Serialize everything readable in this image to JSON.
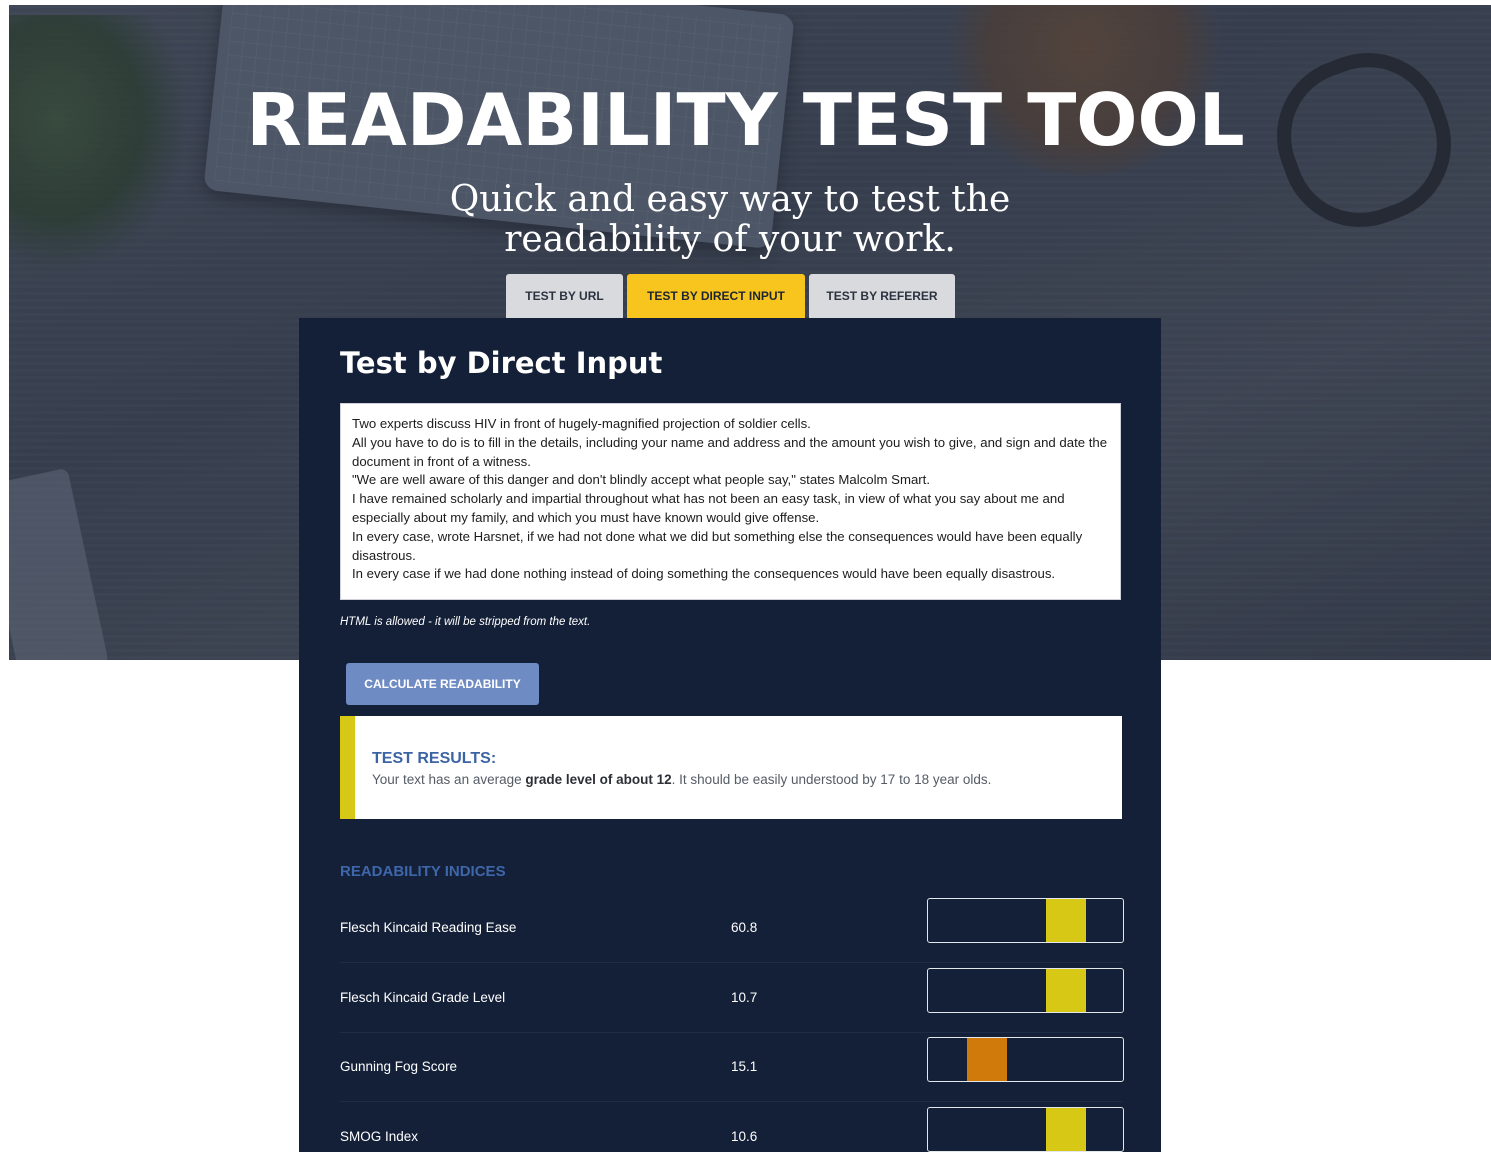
{
  "header": {
    "title": "READABILITY TEST TOOL",
    "subtitle": "Quick and easy way to test the readability of your work."
  },
  "tabs": [
    {
      "label": "TEST BY URL",
      "active": false
    },
    {
      "label": "TEST BY DIRECT INPUT",
      "active": true
    },
    {
      "label": "TEST BY REFERER",
      "active": false
    }
  ],
  "panel": {
    "title": "Test by Direct Input",
    "input_text": "Two experts discuss HIV in front of hugely-magnified projection of soldier cells.\nAll you have to do is to fill in the details, including your name and address and the amount you wish to give, and sign and date the document in front of a witness.\n\"We are well aware of this danger and don't blindly accept what people say,\" states Malcolm Smart.\nI have remained scholarly and impartial throughout what has not been an easy task, in view of what you say about me and especially about my family, and which you must have known would give offense.\nIn every case, wrote Harsnet, if we had not done what we did but something else the consequences would have been equally disastrous.\nIn every case if we had done nothing instead of doing something the consequences would have been equally disastrous.",
    "input_note": "HTML is allowed - it will be stripped from the text.",
    "calculate_label": "CALCULATE READABILITY"
  },
  "results": {
    "label": "TEST RESULTS:",
    "text_prefix": "Your text has an average",
    "grade_bold": "grade level of about 12",
    "text_suffix": ". It should be easily understood by 17 to 18 year olds."
  },
  "indices": {
    "title": "READABILITY INDICES",
    "items": [
      {
        "name": "Flesch Kincaid Reading Ease",
        "value": "60.8",
        "marker_position": 0.6,
        "marker_color": "#d6c814"
      },
      {
        "name": "Flesch Kincaid Grade Level",
        "value": "10.7",
        "marker_position": 0.6,
        "marker_color": "#d6c814"
      },
      {
        "name": "Gunning Fog Score",
        "value": "15.1",
        "marker_position": 0.2,
        "marker_color": "#d17a0c"
      },
      {
        "name": "SMOG Index",
        "value": "10.6",
        "marker_position": 0.6,
        "marker_color": "#d6c814"
      }
    ]
  },
  "colors": {
    "accent_yellow": "#f7c51e",
    "panel_bg": "#142038",
    "button_blue": "#6f8bc3"
  }
}
